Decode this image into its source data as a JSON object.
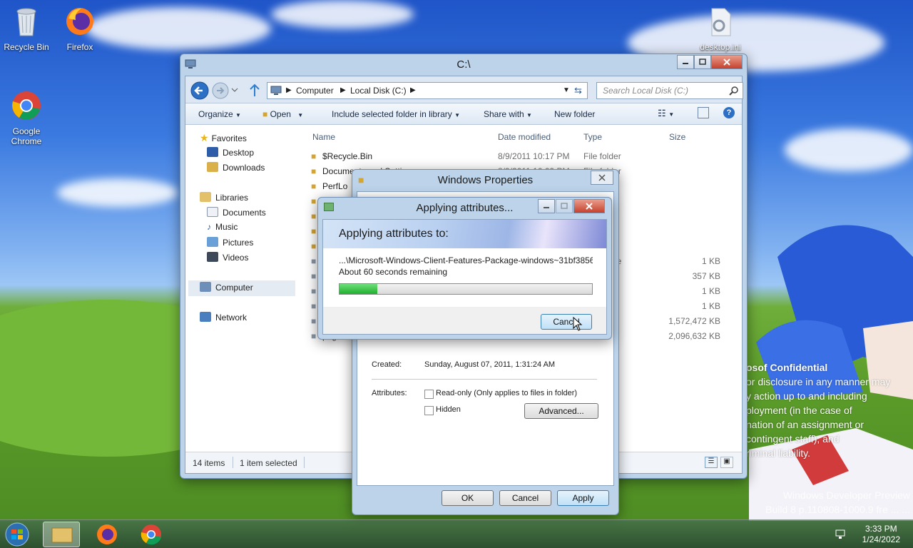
{
  "desktop_icons": [
    {
      "label": "Recycle Bin",
      "icon": "recycle-bin-icon"
    },
    {
      "label": "Firefox",
      "icon": "firefox-icon"
    },
    {
      "label": "Google\nChrome",
      "icon": "chrome-icon"
    },
    {
      "label": "desktop.ini",
      "icon": "settings-file-icon"
    }
  ],
  "wallpaper_text": {
    "confidential_title": "osof  Confidential",
    "confidential_lines": [
      "or disclosure in any manner may",
      "y action up to and including",
      "ployment (in the case of",
      "nation of an assignment or",
      " contingent staff), and",
      "riminal liability."
    ],
    "build_lines": [
      "Windows Developer Preview",
      "Build 8     p.110808-1000.9     fre   ...   ..."
    ]
  },
  "explorer": {
    "title": "C:\\",
    "breadcrumb": [
      "Computer",
      "Local Disk (C:)"
    ],
    "search_placeholder": "Search Local Disk (C:)",
    "commands": {
      "organize": "Organize",
      "open": "Open",
      "include": "Include selected folder in library",
      "share": "Share with",
      "new_folder": "New folder"
    },
    "sidebar": {
      "favorites": "Favorites",
      "desktop": "Desktop",
      "downloads": "Downloads",
      "libraries": "Libraries",
      "documents": "Documents",
      "music": "Music",
      "pictures": "Pictures",
      "videos": "Videos",
      "computer": "Computer",
      "network": "Network"
    },
    "columns": {
      "name": "Name",
      "date": "Date modified",
      "type": "Type",
      "size": "Size"
    },
    "files": [
      {
        "name": "$Recycle.Bin",
        "date": "8/9/2011 10:17 PM",
        "type": "File folder",
        "size": ""
      },
      {
        "name": "Documents and Settings",
        "date": "8/9/2011 10:09 PM",
        "type": "File folder",
        "size": ""
      },
      {
        "name": "PerfLo",
        "date": "",
        "type": "",
        "size": ""
      },
      {
        "name": "P",
        "date": "",
        "type": "",
        "size": ""
      },
      {
        "name": "",
        "date": "",
        "type": "",
        "size": ""
      },
      {
        "name": "",
        "date": "",
        "type": "",
        "size": ""
      },
      {
        "name": "",
        "date": "",
        "type": "",
        "size": ""
      },
      {
        "name": "",
        "date": "",
        "type": "Batch File",
        "size": "1 KB"
      },
      {
        "name": "",
        "date": "",
        "type": "e",
        "size": "357 KB"
      },
      {
        "name": "",
        "date": "",
        "type": "e",
        "size": "1 KB"
      },
      {
        "name": "",
        "date": "",
        "type": "e",
        "size": "1 KB"
      },
      {
        "name": "",
        "date": "",
        "type": "e",
        "size": "1,572,472 KB"
      },
      {
        "name": "pagefil",
        "date": "",
        "type": "e",
        "size": "2,096,632 KB"
      }
    ],
    "status": {
      "items": "14 items",
      "selected": "1 item selected"
    }
  },
  "properties": {
    "title": "Windows Properties",
    "created_label": "Created:",
    "created_value": "Sunday, August 07, 2011, 1:31:24 AM",
    "attributes_label": "Attributes:",
    "readonly_label": "Read-only (Only applies to files in folder)",
    "hidden_label": "Hidden",
    "advanced_button": "Advanced...",
    "ok_button": "OK",
    "cancel_button": "Cancel",
    "apply_button": "Apply"
  },
  "applying": {
    "title": "Applying attributes...",
    "heading": "Applying attributes to:",
    "path": "...\\Microsoft-Windows-Client-Features-Package-windows~31bf3856",
    "remaining": "About 60 seconds remaining",
    "progress": 0.15,
    "cancel_button": "Cancel"
  },
  "taskbar": {
    "time": "3:33 PM",
    "date": "1/24/2022"
  },
  "colors": {
    "accent": "#3c7fb1",
    "progress_green": "#1fae2f",
    "title_glass": "#bcd3ea"
  }
}
